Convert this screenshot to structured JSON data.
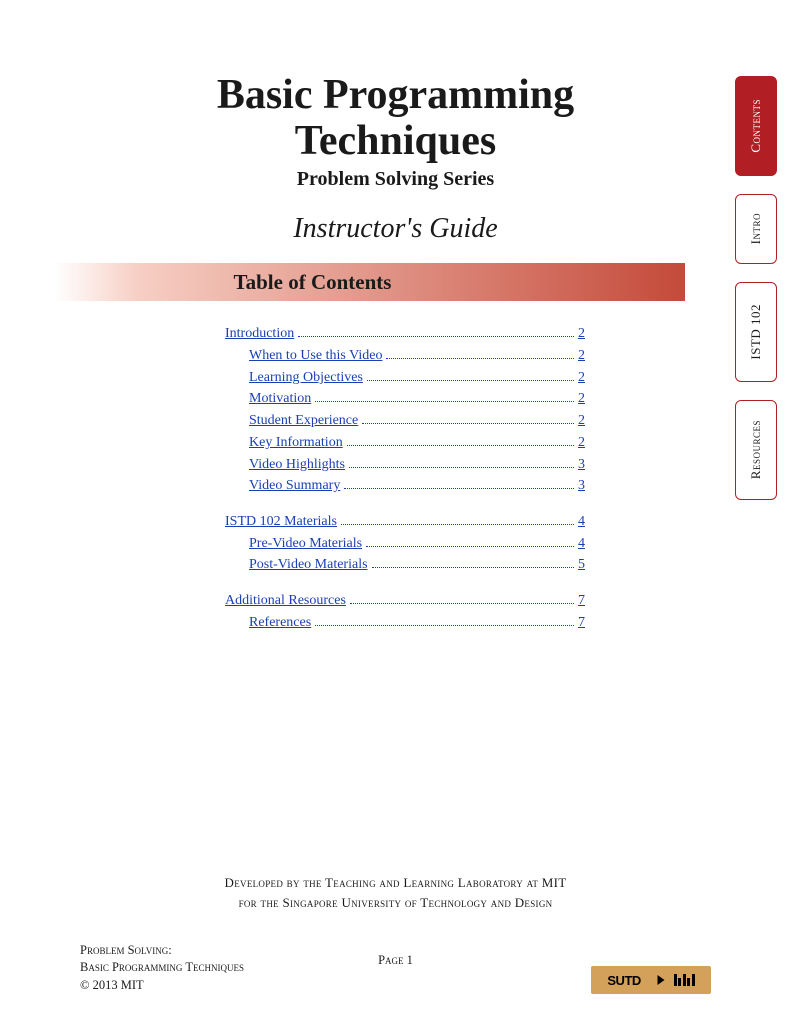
{
  "title_line1": "Basic Programming",
  "title_line2": "Techniques",
  "subtitle": "Problem Solving Series",
  "guide": "Instructor's Guide",
  "toc_header": "Table of Contents",
  "toc_groups": [
    {
      "top": {
        "label": "Introduction",
        "page": "2"
      },
      "items": [
        {
          "label": "When to Use this Video",
          "page": "2"
        },
        {
          "label": "Learning Objectives",
          "page": "2"
        },
        {
          "label": "Motivation",
          "page": "2"
        },
        {
          "label": "Student Experience",
          "page": "2"
        },
        {
          "label": "Key Information",
          "page": "2"
        },
        {
          "label": "Video Highlights",
          "page": "3"
        },
        {
          "label": "Video Summary",
          "page": "3"
        }
      ]
    },
    {
      "top": {
        "label": "ISTD 102 Materials",
        "page": "4"
      },
      "items": [
        {
          "label": "Pre-Video Materials",
          "page": "4"
        },
        {
          "label": "Post-Video Materials",
          "page": "5"
        }
      ]
    },
    {
      "top": {
        "label": "Additional Resources",
        "page": "7"
      },
      "items": [
        {
          "label": "References",
          "page": "7"
        }
      ]
    }
  ],
  "tabs": [
    {
      "label": "Contents",
      "active": true,
      "hclass": "h100"
    },
    {
      "label": "Intro",
      "active": false,
      "hclass": "h70"
    },
    {
      "label": "ISTD 102",
      "active": false,
      "hclass": "h100"
    },
    {
      "label": "Resources",
      "active": false,
      "hclass": "h100"
    }
  ],
  "credit_line1": "Developed by the Teaching and Learning Laboratory at MIT",
  "credit_line2": "for the Singapore University of Technology and Design",
  "footer": {
    "line1": "Problem Solving:",
    "line2": "Basic Programming Techniques",
    "line3": "© 2013 MIT",
    "center": "Page 1",
    "logo_sutd": "SUTD",
    "logo_mit": "MIT"
  }
}
